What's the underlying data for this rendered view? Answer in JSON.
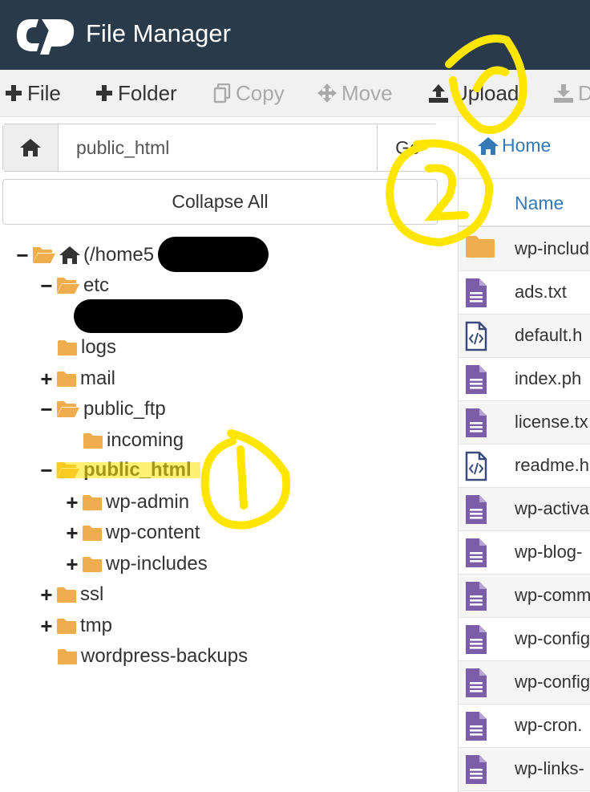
{
  "header": {
    "title": "File Manager",
    "logo_icon": "cpanel-logo-icon",
    "background": "#293a4a"
  },
  "toolbar": {
    "file_label": "File",
    "folder_label": "Folder",
    "copy_label": "Copy",
    "move_label": "Move",
    "upload_label": "Upload",
    "download_label": "D"
  },
  "pathbar": {
    "value": "public_html",
    "go_label": "Go"
  },
  "collapse_label": "Collapse All",
  "tree": {
    "root": "(/home5",
    "etc": "etc",
    "logs": "logs",
    "mail": "mail",
    "public_ftp": "public_ftp",
    "incoming": "incoming",
    "public_html": "public_html",
    "wp_admin": "wp-admin",
    "wp_content": "wp-content",
    "wp_includes": "wp-includes",
    "ssl": "ssl",
    "tmp": "tmp",
    "wordpress_backups": "wordpress-backups"
  },
  "right": {
    "breadcrumb_home": "Home",
    "column_name": "Name",
    "files": [
      {
        "name": "wp-includ",
        "icon": "folder-icon"
      },
      {
        "name": "ads.txt",
        "icon": "text-file-icon"
      },
      {
        "name": "default.h",
        "icon": "code-file-icon"
      },
      {
        "name": "index.ph",
        "icon": "text-file-icon"
      },
      {
        "name": "license.tx",
        "icon": "text-file-icon"
      },
      {
        "name": "readme.h",
        "icon": "code-file-icon"
      },
      {
        "name": "wp-activa",
        "icon": "text-file-icon"
      },
      {
        "name": "wp-blog-",
        "icon": "text-file-icon"
      },
      {
        "name": "wp-comm",
        "icon": "text-file-icon"
      },
      {
        "name": "wp-config",
        "icon": "text-file-icon"
      },
      {
        "name": "wp-config",
        "icon": "text-file-icon"
      },
      {
        "name": "wp-cron.",
        "icon": "text-file-icon"
      },
      {
        "name": "wp-links-",
        "icon": "text-file-icon"
      }
    ]
  },
  "colors": {
    "folder": "#f0ad4e",
    "file": "#7b5ea7",
    "link": "#337ab7",
    "highlight": "#ffe600",
    "redaction": "#000000"
  }
}
